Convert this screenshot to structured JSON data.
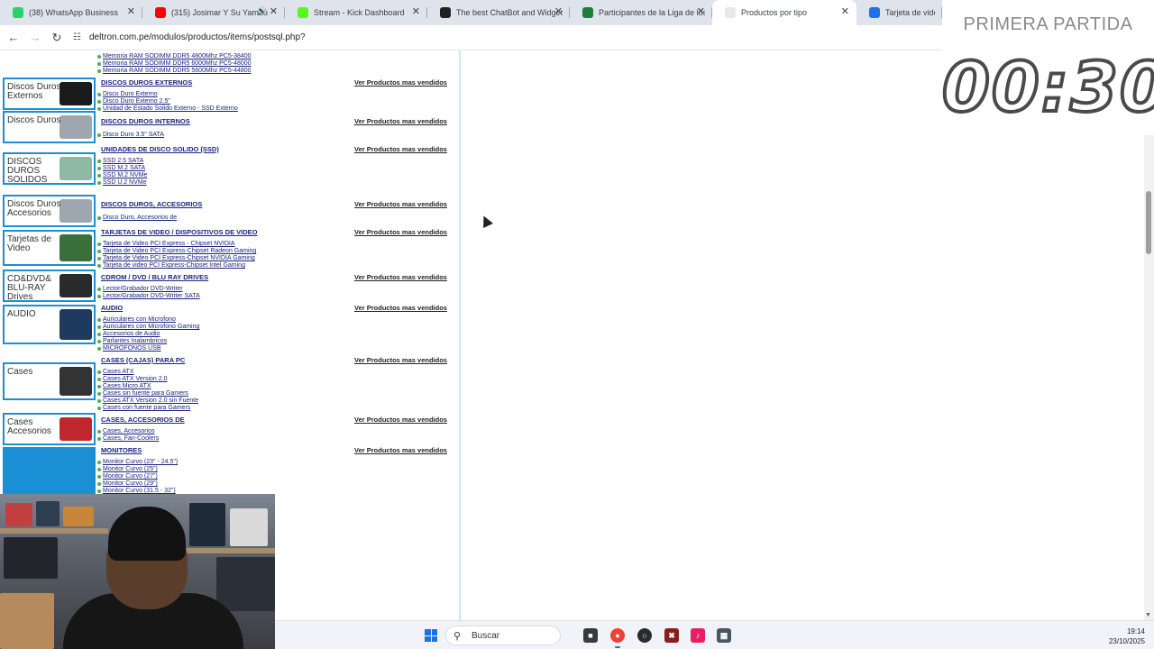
{
  "browser": {
    "tabs": [
      {
        "label": "(38) WhatsApp Business",
        "color": "#25d366",
        "active": false,
        "sound": false
      },
      {
        "label": "(315) Josimar Y Su Yambú",
        "color": "#ff0000",
        "active": false,
        "sound": true
      },
      {
        "label": "Stream - Kick Dashboard",
        "color": "#53fc18",
        "active": false,
        "sound": false
      },
      {
        "label": "The best ChatBot and Widgets",
        "color": "#202020",
        "active": false,
        "sound": false
      },
      {
        "label": "Participantes de la Liga de los",
        "color": "#188038",
        "active": false,
        "sound": false
      },
      {
        "label": "Productos por tipo",
        "color": "#e8e8e8",
        "active": true,
        "sound": false
      },
      {
        "label": "Tarjeta de vide",
        "color": "#1a73e8",
        "active": false,
        "sound": false
      }
    ],
    "url": "deltron.com.pe/modulos/productos/items/postsql.php?"
  },
  "catalog": {
    "more_label": "Ver Productos mas vendidos",
    "top_items": [
      "Memoria RAM SODIMM DDR5 4800Mhz PC5-38400",
      "Memoria RAM SODIMM DDR5 6000Mhz PC5-48000",
      "Memoria RAM SODIMM DDR5 5600Mhz PC5-44800"
    ],
    "categories": [
      {
        "title": "DISCOS DUROS EXTERNOS",
        "img": "Discos Duros Externos",
        "art": "#1b1b1b",
        "items": [
          "Disco Duro Externo",
          "Disco Duro Externo 2.5\"",
          "Unidad de Estado Solido Externo - SSD Externo"
        ]
      },
      {
        "title": "DISCOS DUROS INTERNOS",
        "img": "Discos Duros",
        "art": "#9ea7b0",
        "items": [
          "Disco Duro 3.5\" SATA"
        ]
      },
      {
        "title": "UNIDADES DE DISCO SOLIDO (SSD)",
        "img": "DISCOS DUROS SOLIDOS INTERNOS",
        "art": "#8fb9a3",
        "items": [
          "",
          "SSD 2.5 SATA",
          "SSD M.2 SATA",
          "SSD M.2 NVMe",
          "SSD U.2 NVMe"
        ]
      },
      {
        "title": "DISCOS DUROS, ACCESORIOS",
        "img": "Discos Duros Accesorios",
        "art": "#9ea7b0",
        "items": [
          "Disco Duro, Accesorios de"
        ]
      },
      {
        "title": "TARJETAS DE VIDEO / DISPOSITIVOS DE VIDEO",
        "img": "Tarjetas de Video",
        "art": "#3b6f3a",
        "items": [
          "Tarjeta de Video PCI Express - Chipset NVIDIA",
          "Tarjeta de Video PCI Express-Chipset Radeon Gaming",
          "Tarjeta de Video PCI Express-Chipset NVIDIA Gaming",
          "Tarjeta de video PCI Express-Chipset Intel Gaming"
        ]
      },
      {
        "title": "CDROM / DVD / BLU RAY DRIVES",
        "img": "CD&DVD& BLU-RAY Drives",
        "art": "#2a2a2a",
        "items": [
          "Lector/Grabador DVD-Writer",
          "Lector/Grabador DVD-Writer SATA"
        ]
      },
      {
        "title": "AUDIO",
        "img": "AUDIO",
        "art": "#1e3a5f",
        "items": [
          "Auriculares con Microfono",
          "Auriculares con Microfono Gaming",
          "Accesorios de Audio",
          "Parlantes Inalambricos",
          "MICROFONOS USB"
        ]
      },
      {
        "title": "CASES (CAJAS) PARA PC",
        "img": "Cases",
        "art": "#333333",
        "items": [
          "Cases ATX",
          "Cases ATX Version 2.0",
          "Cases Micro ATX",
          "Cases sin fuente para Gamers",
          "Cases ATX Version 2.0 sin Fuente",
          "Cases con fuente para Gamers"
        ]
      },
      {
        "title": "CASES, ACCESORIOS DE",
        "img": "Cases Accesorios",
        "art": "#c0262d",
        "items": [
          "Cases, Accesorios",
          "Cases, Fan-Coolers"
        ]
      },
      {
        "title": "MONITORES",
        "img": "",
        "art": "#1a8fd6",
        "items": [
          "Monitor Curvo (23\" - 24.5\")",
          "Monitor Curvo (25\")",
          "Monitor Curvo (27\")",
          "Monitor Curvo (29\")",
          "Monitor Curvo (31.5 - 32\")"
        ]
      }
    ]
  },
  "overlay": {
    "label": "PRIMERA PARTIDA",
    "timer": "00:30"
  },
  "taskbar": {
    "search_label": "Buscar",
    "time": "19:14",
    "date": "23/10/2025"
  }
}
